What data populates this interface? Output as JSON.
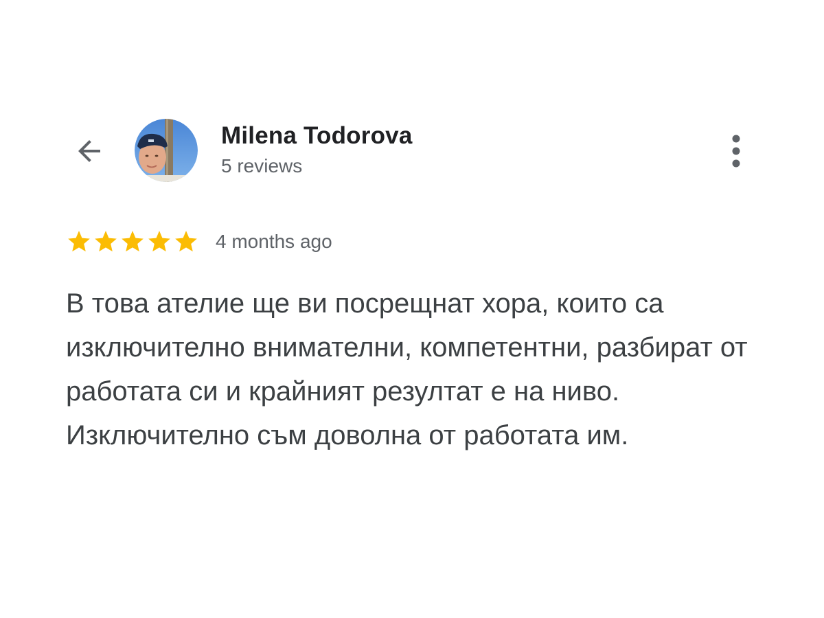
{
  "reviewer": {
    "name": "Milena Todorova",
    "review_count": "5 reviews"
  },
  "review": {
    "rating": 5,
    "rating_max": 5,
    "time_ago": "4 months ago",
    "text": "В това ателие ще ви посрещнат хора, които са изключително внимателни, компетентни, разбират от работата си и крайният резултат е на ниво. Изключително съм доволна от работата им."
  },
  "icons": {
    "back": "arrow-back-icon",
    "more": "more-vert-icon",
    "star": "star-icon"
  },
  "colors": {
    "star": "#fbbc04",
    "name": "#202124",
    "secondary_text": "#5f6368",
    "body_text": "#3c4043",
    "icon": "#5f6368"
  }
}
